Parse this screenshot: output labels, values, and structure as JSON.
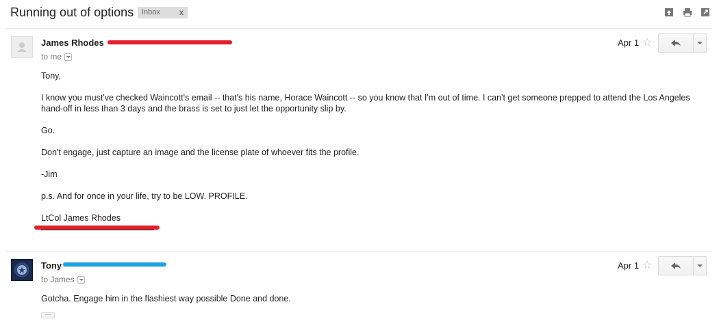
{
  "thread": {
    "subject": "Running out of options",
    "label": "Inbox",
    "label_remove": "x",
    "icons": [
      "archive-icon",
      "print-icon",
      "new-window-icon"
    ]
  },
  "messages": [
    {
      "sender": "James Rhodes",
      "recipient": "to me",
      "date": "Apr 1",
      "star": "☆",
      "body": {
        "greeting": "Tony,",
        "para1": "I know you must've checked Waincott's email -- that's his name, Horace Waincott -- so you know that I'm out of time.  I can't get someone prepped to attend the Los Angeles hand-off in less than 3 days and the brass is set to just let the opportunity slip by.",
        "para2": "Go.",
        "para3": "Don't engage, just capture an image and the license plate of whoever fits the profile.",
        "para4": "-Jim",
        "para5": "p.s. And for once in your life, try to be LOW. PROFILE.",
        "signature": "LtCol James Rhodes"
      },
      "redaction_color": "#e0202a"
    },
    {
      "sender": "Tony",
      "recipient": "to James",
      "date": "Apr 1",
      "star": "☆",
      "body": {
        "line1": "Gotcha.  Engage him in the flashiest way possible  Done and done."
      },
      "trimmed_content": "···",
      "redaction_color": "#1aa3e0"
    }
  ]
}
